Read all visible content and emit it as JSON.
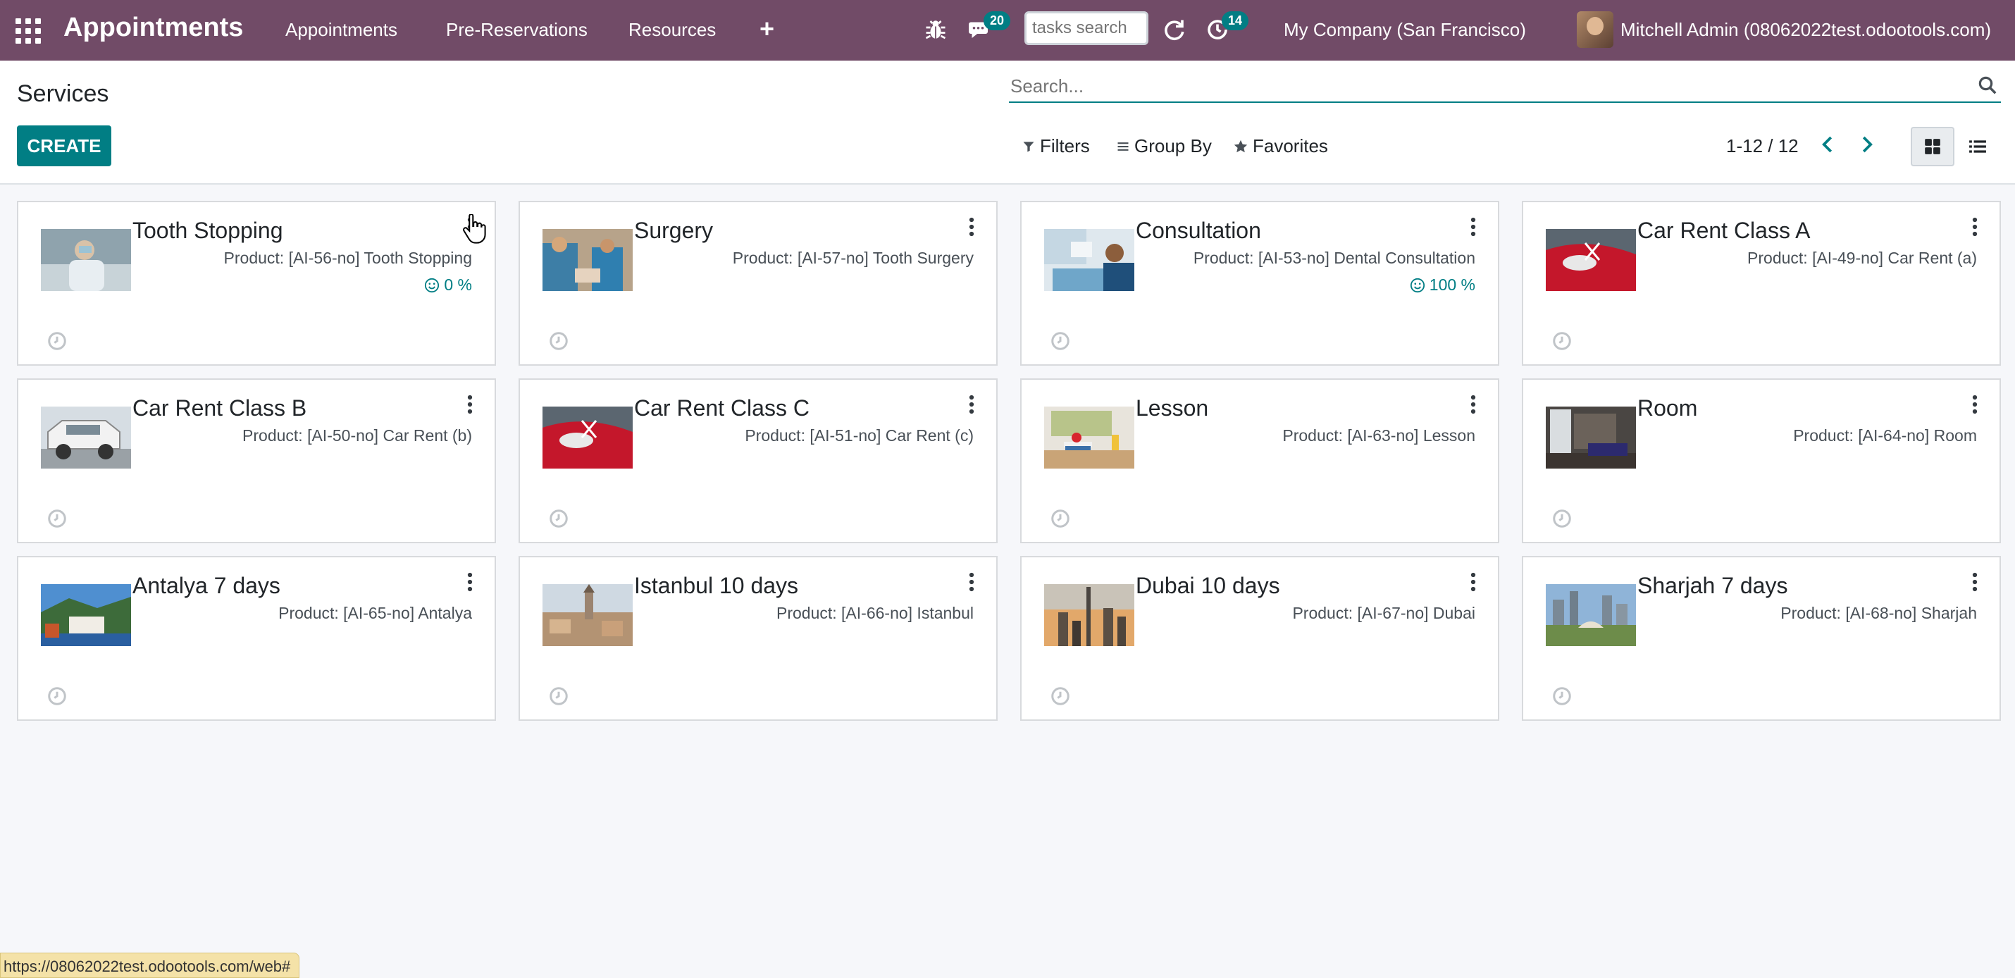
{
  "navbar": {
    "app_name": "Appointments",
    "menu": [
      "Appointments",
      "Pre-Reservations",
      "Resources"
    ],
    "add_label": "+",
    "chat_badge": "20",
    "tasks_search_placeholder": "tasks search",
    "activity_badge": "14",
    "company": "My Company (San Francisco)",
    "user": "Mitchell Admin (08062022test.odootools.com)"
  },
  "control_panel": {
    "title": "Services",
    "create_label": "CREATE",
    "search_placeholder": "Search...",
    "filters_label": "Filters",
    "group_by_label": "Group By",
    "favorites_label": "Favorites",
    "pager": "1-12 / 12"
  },
  "cards": [
    {
      "title": "Tooth Stopping",
      "product": "Product: [AI-56-no] Tooth Stopping",
      "rating": "0 %"
    },
    {
      "title": "Surgery",
      "product": "Product: [AI-57-no] Tooth Surgery",
      "rating": ""
    },
    {
      "title": "Consultation",
      "product": "Product: [AI-53-no] Dental Consultation",
      "rating": "100 %"
    },
    {
      "title": "Car Rent Class A",
      "product": "Product: [AI-49-no] Car Rent (a)",
      "rating": ""
    },
    {
      "title": "Car Rent Class B",
      "product": "Product: [AI-50-no] Car Rent (b)",
      "rating": ""
    },
    {
      "title": "Car Rent Class C",
      "product": "Product: [AI-51-no] Car Rent (c)",
      "rating": ""
    },
    {
      "title": "Lesson",
      "product": "Product: [AI-63-no] Lesson",
      "rating": ""
    },
    {
      "title": "Room",
      "product": "Product: [AI-64-no] Room",
      "rating": ""
    },
    {
      "title": "Antalya 7 days",
      "product": "Product: [AI-65-no] Antalya",
      "rating": ""
    },
    {
      "title": "Istanbul 10 days",
      "product": "Product: [AI-66-no] Istanbul",
      "rating": ""
    },
    {
      "title": "Dubai 10 days",
      "product": "Product: [AI-67-no] Dubai",
      "rating": ""
    },
    {
      "title": "Sharjah 7 days",
      "product": "Product: [AI-68-no] Sharjah",
      "rating": ""
    }
  ],
  "status_bar_url": "https://08062022test.odootools.com/web#",
  "colors": {
    "brand": "#714b67",
    "accent": "#017e84",
    "background": "#f6f7fa"
  }
}
